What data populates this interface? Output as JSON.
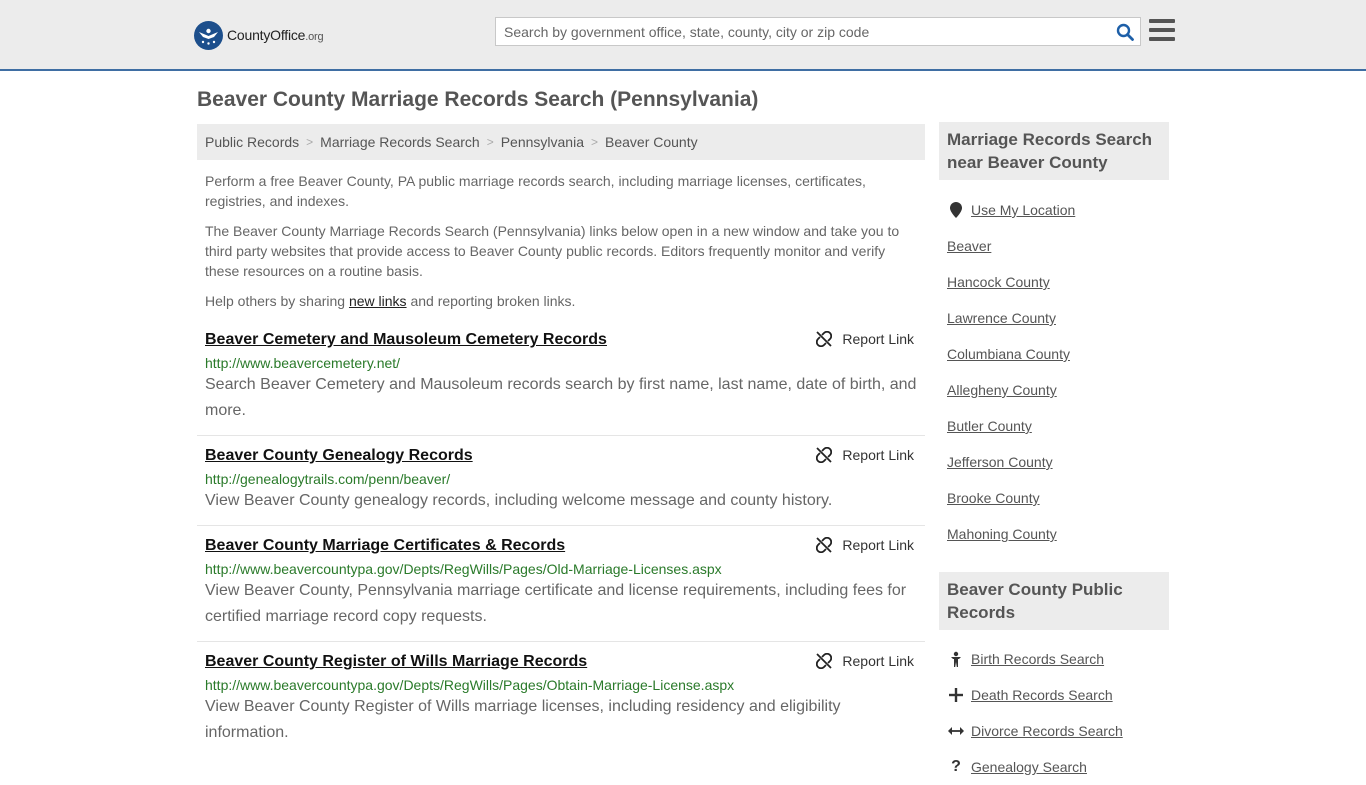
{
  "header": {
    "logo_text": "CountyOffice",
    "logo_suffix": ".org",
    "search_placeholder": "Search by government office, state, county, city or zip code"
  },
  "page": {
    "title": "Beaver County Marriage Records Search (Pennsylvania)"
  },
  "breadcrumb": [
    "Public Records",
    "Marriage Records Search",
    "Pennsylvania",
    "Beaver County"
  ],
  "intro": {
    "p1": "Perform a free Beaver County, PA public marriage records search, including marriage licenses, certificates, registries, and indexes.",
    "p2": "The Beaver County Marriage Records Search (Pennsylvania) links below open in a new window and take you to third party websites that provide access to Beaver County public records. Editors frequently monitor and verify these resources on a routine basis.",
    "p3_before": "Help others by sharing ",
    "p3_link": "new links",
    "p3_after": " and reporting broken links."
  },
  "report_label": "Report Link",
  "results": [
    {
      "title": "Beaver Cemetery and Mausoleum Cemetery Records",
      "url": "http://www.beavercemetery.net/",
      "desc": "Search Beaver Cemetery and Mausoleum records search by first name, last name, date of birth, and more."
    },
    {
      "title": "Beaver County Genealogy Records",
      "url": "http://genealogytrails.com/penn/beaver/",
      "desc": "View Beaver County genealogy records, including welcome message and county history."
    },
    {
      "title": "Beaver County Marriage Certificates & Records",
      "url": "http://www.beavercountypa.gov/Depts/RegWills/Pages/Old-Marriage-Licenses.aspx",
      "desc": "View Beaver County, Pennsylvania marriage certificate and license requirements, including fees for certified marriage record copy requests."
    },
    {
      "title": "Beaver County Register of Wills Marriage Records",
      "url": "http://www.beavercountypa.gov/Depts/RegWills/Pages/Obtain-Marriage-License.aspx",
      "desc": "View Beaver County Register of Wills marriage licenses, including residency and eligibility information."
    }
  ],
  "sidebar": {
    "nearby_heading": "Marriage Records Search near Beaver County",
    "use_location": "Use My Location",
    "nearby": [
      "Beaver",
      "Hancock County",
      "Lawrence County",
      "Columbiana County",
      "Allegheny County",
      "Butler County",
      "Jefferson County",
      "Brooke County",
      "Mahoning County"
    ],
    "public_heading": "Beaver County Public Records",
    "public_links": [
      {
        "label": "Birth Records Search",
        "icon": "baby-icon"
      },
      {
        "label": "Death Records Search",
        "icon": "cross-icon"
      },
      {
        "label": "Divorce Records Search",
        "icon": "arrows-horizontal-icon"
      },
      {
        "label": "Genealogy Search",
        "icon": "question-icon"
      }
    ]
  }
}
